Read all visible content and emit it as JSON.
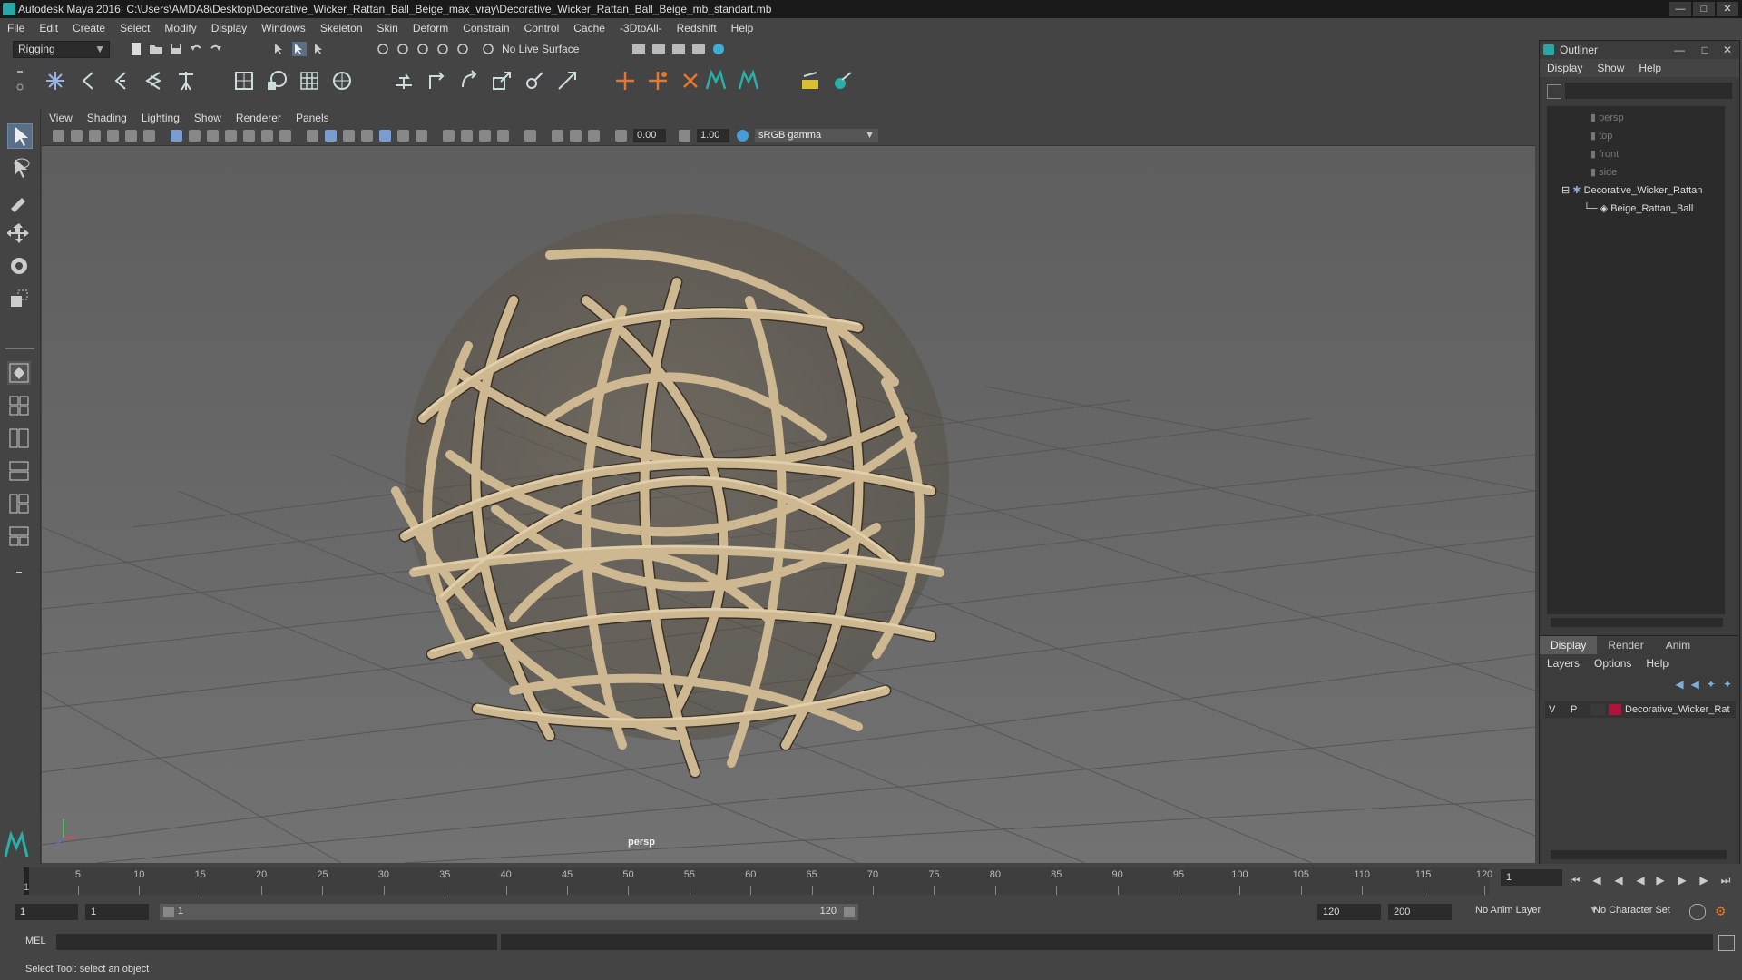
{
  "window": {
    "title": "Autodesk Maya 2016: C:\\Users\\AMDA8\\Desktop\\Decorative_Wicker_Rattan_Ball_Beige_max_vray\\Decorative_Wicker_Rattan_Ball_Beige_mb_standart.mb"
  },
  "menu": [
    "File",
    "Edit",
    "Create",
    "Select",
    "Modify",
    "Display",
    "Windows",
    "Skeleton",
    "Skin",
    "Deform",
    "Constrain",
    "Control",
    "Cache",
    "-3DtoAll-",
    "Redshift",
    "Help"
  ],
  "shelf": {
    "mode": "Rigging",
    "live_surface": "No Live Surface"
  },
  "viewport": {
    "menu": [
      "View",
      "Shading",
      "Lighting",
      "Show",
      "Renderer",
      "Panels"
    ],
    "near": "0.00",
    "far": "1.00",
    "color_space": "sRGB gamma",
    "camera_label": "persp"
  },
  "outliner": {
    "title": "Outliner",
    "menu": [
      "Display",
      "Show",
      "Help"
    ],
    "items": [
      "persp",
      "top",
      "front",
      "side",
      "Decorative_Wicker_Rattan",
      "Beige_Rattan_Ball"
    ]
  },
  "layers": {
    "tabs": [
      "Display",
      "Render",
      "Anim"
    ],
    "menu": [
      "Layers",
      "Options",
      "Help"
    ],
    "row": {
      "v": "V",
      "p": "P",
      "name": "Decorative_Wicker_Rat",
      "color": "#b0143c"
    }
  },
  "timeline": {
    "ticks": [
      5,
      10,
      15,
      20,
      25,
      30,
      35,
      40,
      45,
      50,
      55,
      60,
      65,
      70,
      75,
      80,
      85,
      90,
      95,
      100,
      105,
      110,
      115,
      120
    ],
    "first": "1",
    "current": "1"
  },
  "range": {
    "start": "1",
    "playback_start": "1",
    "slider_start": "1",
    "slider_end": "120",
    "playback_end": "120",
    "end": "200",
    "anim_layer": "No Anim Layer",
    "character_set": "No Character Set"
  },
  "cmd": {
    "label": "MEL"
  },
  "help": {
    "text": "Select Tool: select an object"
  }
}
